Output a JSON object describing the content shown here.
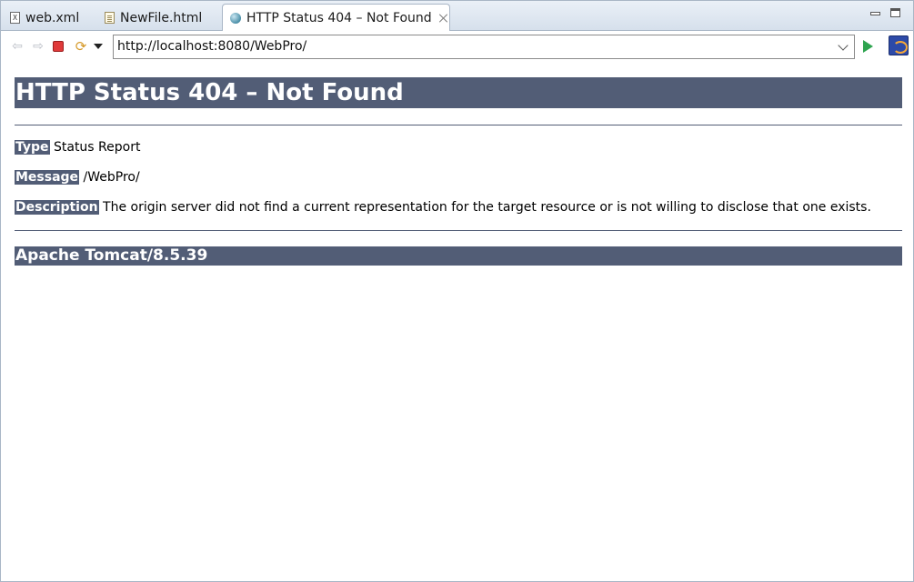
{
  "tabs": [
    {
      "label": "web.xml",
      "icon": "xml-file-icon"
    },
    {
      "label": "NewFile.html",
      "icon": "html-file-icon"
    },
    {
      "label": "HTTP Status 404 – Not Found",
      "icon": "globe-icon",
      "active": true
    }
  ],
  "xml_icon_glyph": "X",
  "toolbar": {
    "url": "http://localhost:8080/WebPro/"
  },
  "page": {
    "title": "HTTP Status 404 – Not Found",
    "type_label": "Type",
    "type_value": "Status Report",
    "message_label": "Message",
    "message_value": "/WebPro/",
    "description_label": "Description",
    "description_value": "The origin server did not find a current representation for the target resource or is not willing to disclose that one exists.",
    "footer": "Apache Tomcat/8.5.39"
  },
  "colors": {
    "heading_bg": "#525d76",
    "heading_fg": "#ffffff"
  }
}
